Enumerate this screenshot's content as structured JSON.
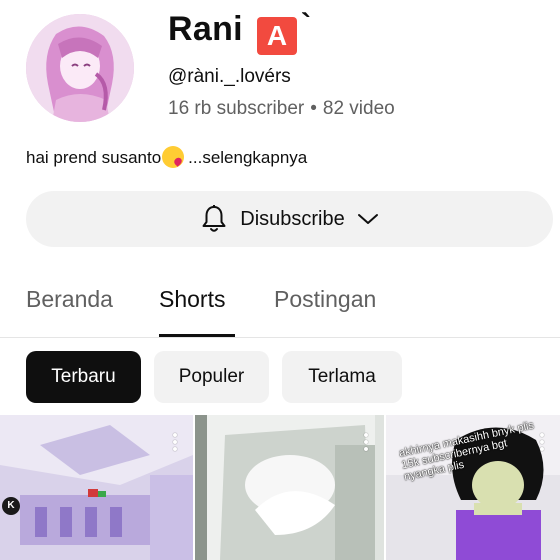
{
  "channel": {
    "name": "Rani",
    "name_badge": "A",
    "name_suffix": "`",
    "handle": "@ràni._.lovérs",
    "subscribers": "16 rb subscriber",
    "separator": "•",
    "videos": "82 video",
    "description": "hai prend susanto",
    "description_emoji": "kissing-heart-emoji",
    "more_label": "...selengkapnya"
  },
  "subscribe_button": {
    "label": "Disubscribe",
    "icon": "bell-icon",
    "dropdown_icon": "chevron-down-icon"
  },
  "tabs": [
    {
      "label": "Beranda",
      "active": false
    },
    {
      "label": "Shorts",
      "active": true
    },
    {
      "label": "Postingan",
      "active": false
    }
  ],
  "chips": [
    {
      "label": "Terbaru",
      "selected": true
    },
    {
      "label": "Populer",
      "selected": false
    },
    {
      "label": "Terlama",
      "selected": false
    }
  ],
  "shorts": [
    {
      "overlay_text": ""
    },
    {
      "overlay_text": ""
    },
    {
      "overlay_text": "akhirnya makasihh bnyk plis 15k subscribernya bgt nyangka plis"
    }
  ],
  "app_badge": "K",
  "colors": {
    "accent_badge": "#f24a3f",
    "chip_selected": "#0f0f0f",
    "button_bg": "#f2f2f2",
    "secondary_text": "#606060"
  }
}
